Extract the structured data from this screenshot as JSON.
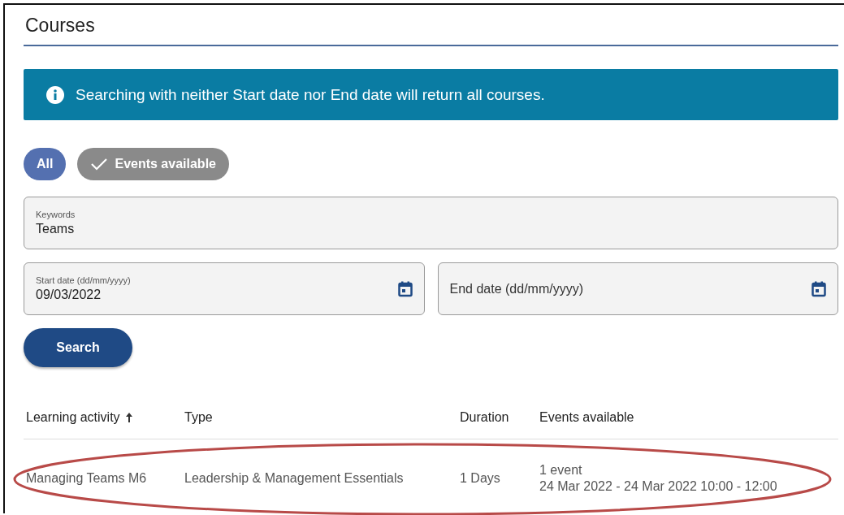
{
  "title": "Courses",
  "banner": {
    "text": "Searching with neither Start date nor End date will return all courses."
  },
  "filters": [
    {
      "label": "All",
      "selected": true,
      "checked": false
    },
    {
      "label": "Events available",
      "selected": false,
      "checked": true
    }
  ],
  "keywords": {
    "label": "Keywords",
    "value": "Teams"
  },
  "start_date": {
    "label": "Start date (dd/mm/yyyy)",
    "value": "09/03/2022"
  },
  "end_date": {
    "placeholder": "End date (dd/mm/yyyy)"
  },
  "search_button": "Search",
  "table": {
    "columns": [
      {
        "label": "Learning activity",
        "sorted": true
      },
      {
        "label": "Type",
        "sorted": false
      },
      {
        "label": "Duration",
        "sorted": false
      },
      {
        "label": "Events available",
        "sorted": false
      }
    ],
    "rows": [
      {
        "activity": "Managing Teams M6",
        "type": "Leadership & Management Essentials",
        "duration": "1 Days",
        "events": [
          "1 event",
          "24 Mar 2022 - 24 Mar 2022 10:00 - 12:00"
        ],
        "highlighted": true
      }
    ]
  }
}
